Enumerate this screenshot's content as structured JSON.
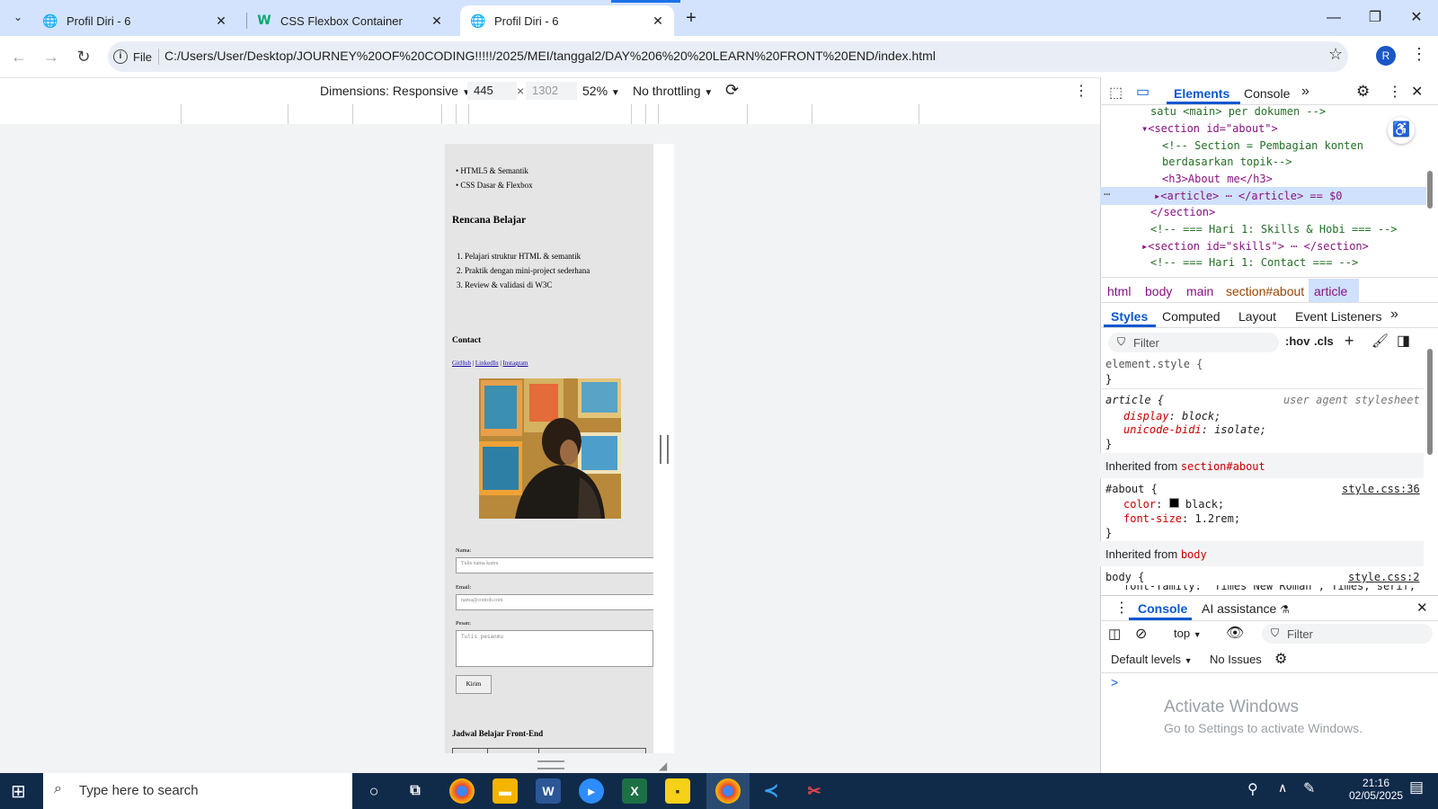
{
  "browser": {
    "tabs": [
      {
        "title": "Profil Diri - 6",
        "favicon": "globe-icon",
        "active": false
      },
      {
        "title": "CSS Flexbox Container",
        "favicon": "w3schools-icon",
        "active": false
      },
      {
        "title": "Profil Diri - 6",
        "favicon": "globe-icon",
        "active": true
      }
    ],
    "file_chip": "File",
    "url": "C:/Users/User/Desktop/JOURNEY%20OF%20CODING!!!!!/2025/MEI/tanggal2/DAY%206%20%20LEARN%20FRONT%20END/index.html",
    "avatar_letter": "R"
  },
  "device_toolbar": {
    "dimensions_label": "Dimensions: Responsive",
    "width": "445",
    "times": "×",
    "height": "1302",
    "zoom": "52%",
    "throttling": "No throttling"
  },
  "page": {
    "bullets": [
      "HTML5 & Semantik",
      "CSS Dasar & Flexbox"
    ],
    "plan_title": "Rencana Belajar",
    "plan_items": [
      "1. Pelajari struktur HTML & semantik",
      "2. Praktik dengan mini-project sederhana",
      "3. Review & validasi di W3C"
    ],
    "contact_title": "Contact",
    "links": [
      "GitHub",
      "LinkedIn",
      "Instagram"
    ],
    "link_sep": "|",
    "form": {
      "name_label": "Nama:",
      "name_placeholder": "Tulis nama kamu",
      "email_label": "Email:",
      "email_placeholder": "nama@contoh.com",
      "message_label": "Pesan:",
      "message_placeholder": "Tulis pesanmu",
      "submit": "Kirim"
    },
    "schedule_title": "Jadwal Belajar Front-End"
  },
  "devtools": {
    "tabs": [
      "Elements",
      "Console"
    ],
    "more": "»",
    "dom_lines": [
      "satu <main> per dokumen -->",
      "<section id=\"about\">",
      "<!-- Section = Pembagian konten",
      "berdasarkan topik-->",
      "<h3>About me</h3>",
      "<article> ⋯ </article> == $0",
      "</section>",
      "<!-- === Hari 1: Skills & Hobi === -->",
      "<section id=\"skills\"> ⋯ </section>",
      "<!-- === Hari 1: Contact === -->"
    ],
    "breadcrumbs": [
      "html",
      "body",
      "main",
      "section#about",
      "article"
    ],
    "style_tabs": [
      "Styles",
      "Computed",
      "Layout",
      "Event Listeners"
    ],
    "filter_placeholder": "Filter",
    "hov": ":hov",
    "cls": ".cls",
    "rules": {
      "element_style": "element.style {",
      "close": "}",
      "article_selector": "article {",
      "article_source": "user agent stylesheet",
      "article_props": [
        [
          "display",
          "block;"
        ],
        [
          "unicode-bidi",
          "isolate;"
        ]
      ],
      "inherited_1": "Inherited from",
      "inherited_1_target": "section#about",
      "about_selector": "#about {",
      "about_source": "style.css:36",
      "about_props": [
        [
          "color",
          "black;"
        ],
        [
          "font-size",
          "1.2rem;"
        ]
      ],
      "inherited_2": "Inherited from",
      "inherited_2_target": "body",
      "body_selector": "body {",
      "body_source": "style.css:2",
      "body_prop": "font-family: \"Times New Roman\", Times, serif;"
    },
    "drawer": {
      "tabs": [
        "Console",
        "AI assistance"
      ],
      "context": "top",
      "filter_placeholder": "Filter",
      "levels": "Default levels",
      "issues": "No Issues",
      "prompt": ">",
      "activate_title": "Activate Windows",
      "activate_sub": "Go to Settings to activate Windows."
    }
  },
  "taskbar": {
    "search_placeholder": "Type here to search",
    "time": "21:16",
    "date": "02/05/2025"
  },
  "colors": {
    "accent": "#1a73e8",
    "tabstrip": "#d3e3fd",
    "taskbar": "#102a4a"
  }
}
